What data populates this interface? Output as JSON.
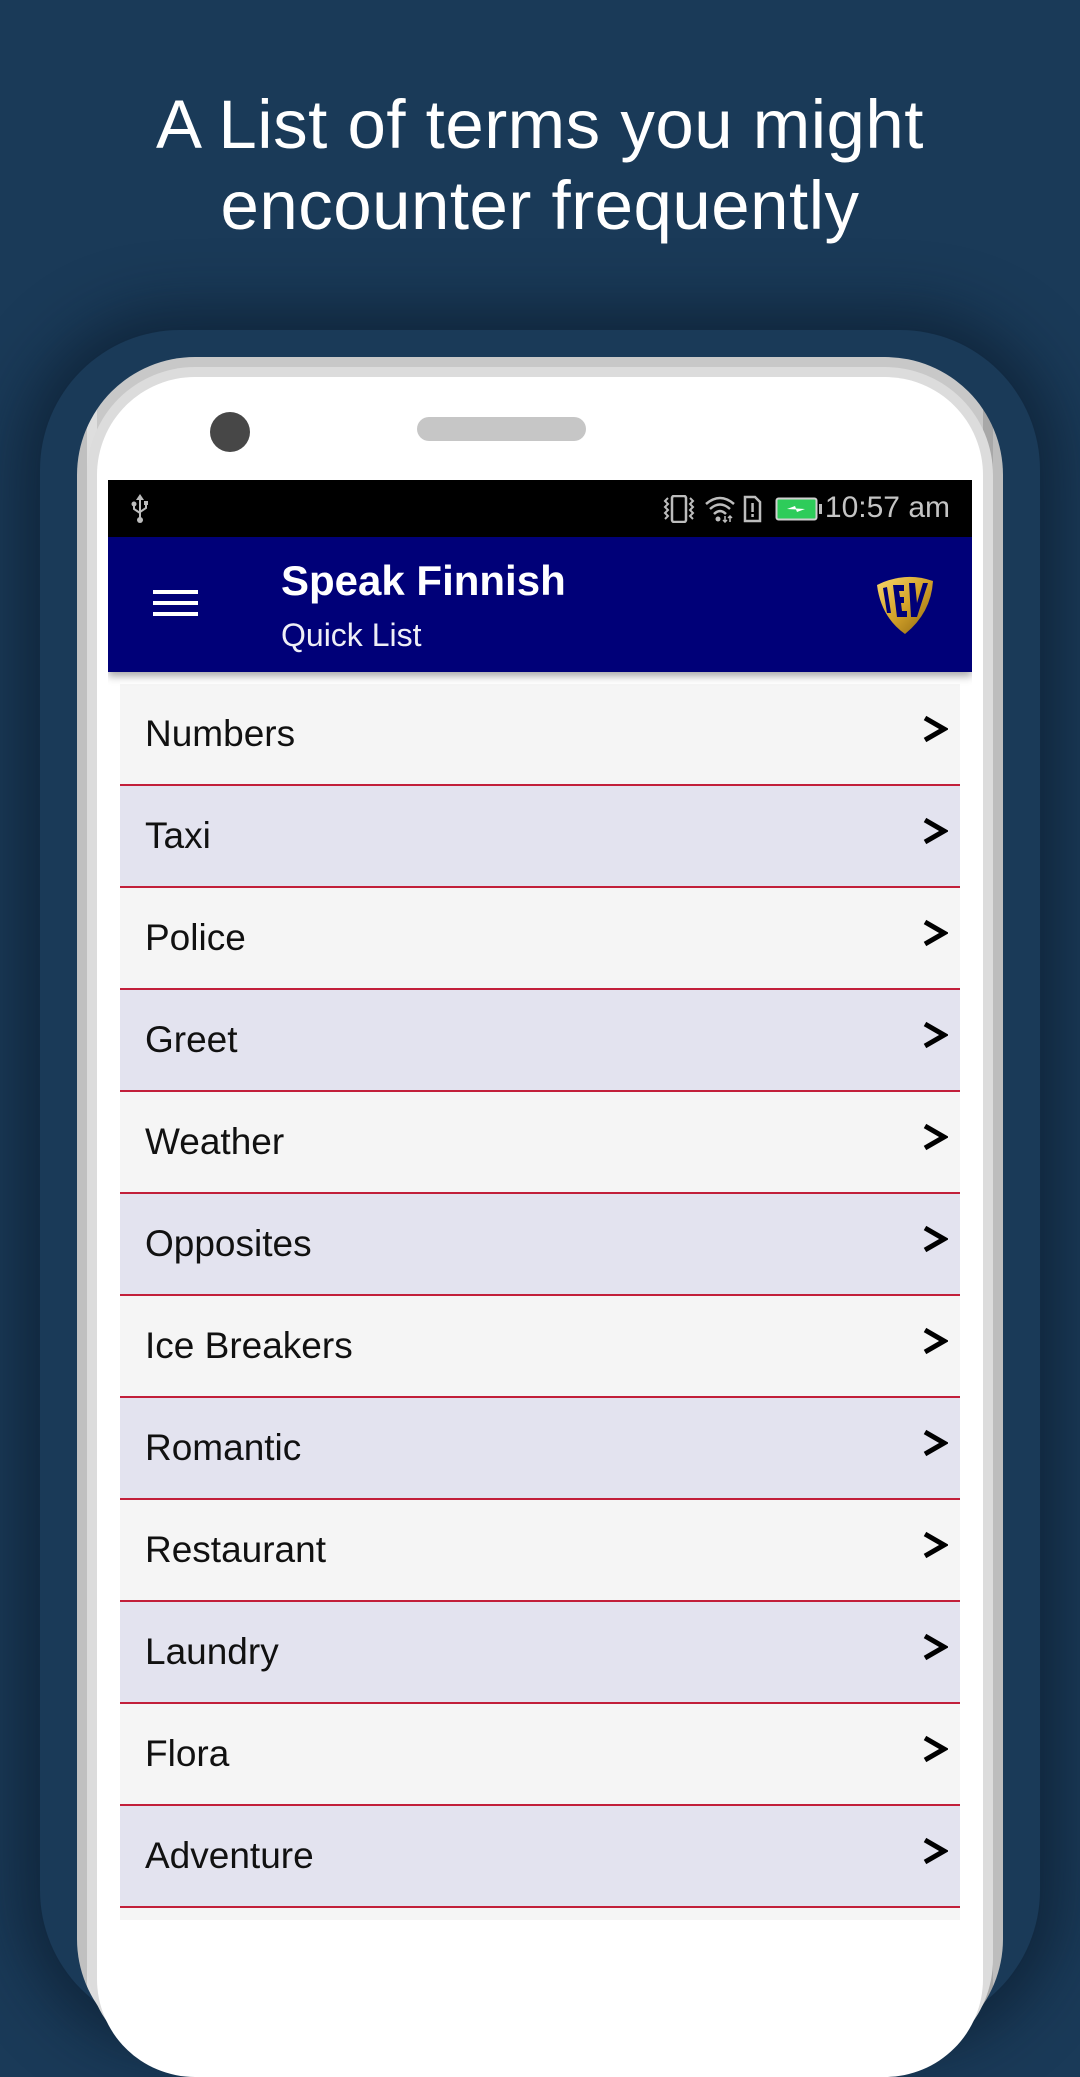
{
  "promo": {
    "headline_line1": "A List of terms you might",
    "headline_line2": "encounter frequently"
  },
  "status_bar": {
    "left_icons": [
      "usb-icon"
    ],
    "right_icons": [
      "vibrate-icon",
      "wifi-icon",
      "sim-alert-icon",
      "battery-charging-icon"
    ],
    "time": "10:57 am",
    "battery_color": "#2ecc5a"
  },
  "app_bar": {
    "menu_icon": "hamburger-menu-icon",
    "title": "Speak Finnish",
    "subtitle": "Quick List",
    "logo_text": "EV",
    "background_color": "#000078"
  },
  "quick_list": {
    "divider_color": "#c21f3a",
    "row_colors": [
      "#f5f5f5",
      "#e3e3ef"
    ],
    "chevron_icon": "chevron-right-icon",
    "items": [
      {
        "label": "Numbers"
      },
      {
        "label": "Taxi"
      },
      {
        "label": "Police"
      },
      {
        "label": "Greet"
      },
      {
        "label": "Weather"
      },
      {
        "label": "Opposites"
      },
      {
        "label": "Ice Breakers"
      },
      {
        "label": "Romantic"
      },
      {
        "label": "Restaurant"
      },
      {
        "label": "Laundry"
      },
      {
        "label": "Flora"
      },
      {
        "label": "Adventure"
      },
      {
        "label": ""
      }
    ]
  }
}
